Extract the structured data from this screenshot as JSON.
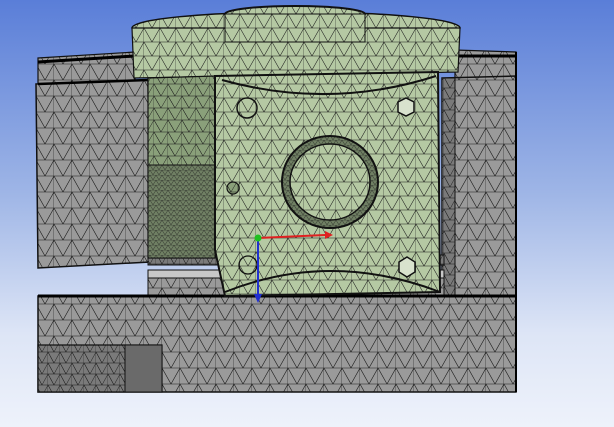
{
  "viewer": {
    "background_top": "#5a7ed8",
    "background_bottom": "#eef2fb"
  },
  "model": {
    "body_color": "#9a9a9a",
    "body_dark_color": "#6e6e6e",
    "part_color": "#b5c9a3",
    "part_dark_color": "#7f9670",
    "edge_color": "#1a1a1a"
  },
  "triad": {
    "x_axis_color": "#e02020",
    "y_axis_color": "#20c020",
    "z_axis_color": "#2030d0"
  }
}
